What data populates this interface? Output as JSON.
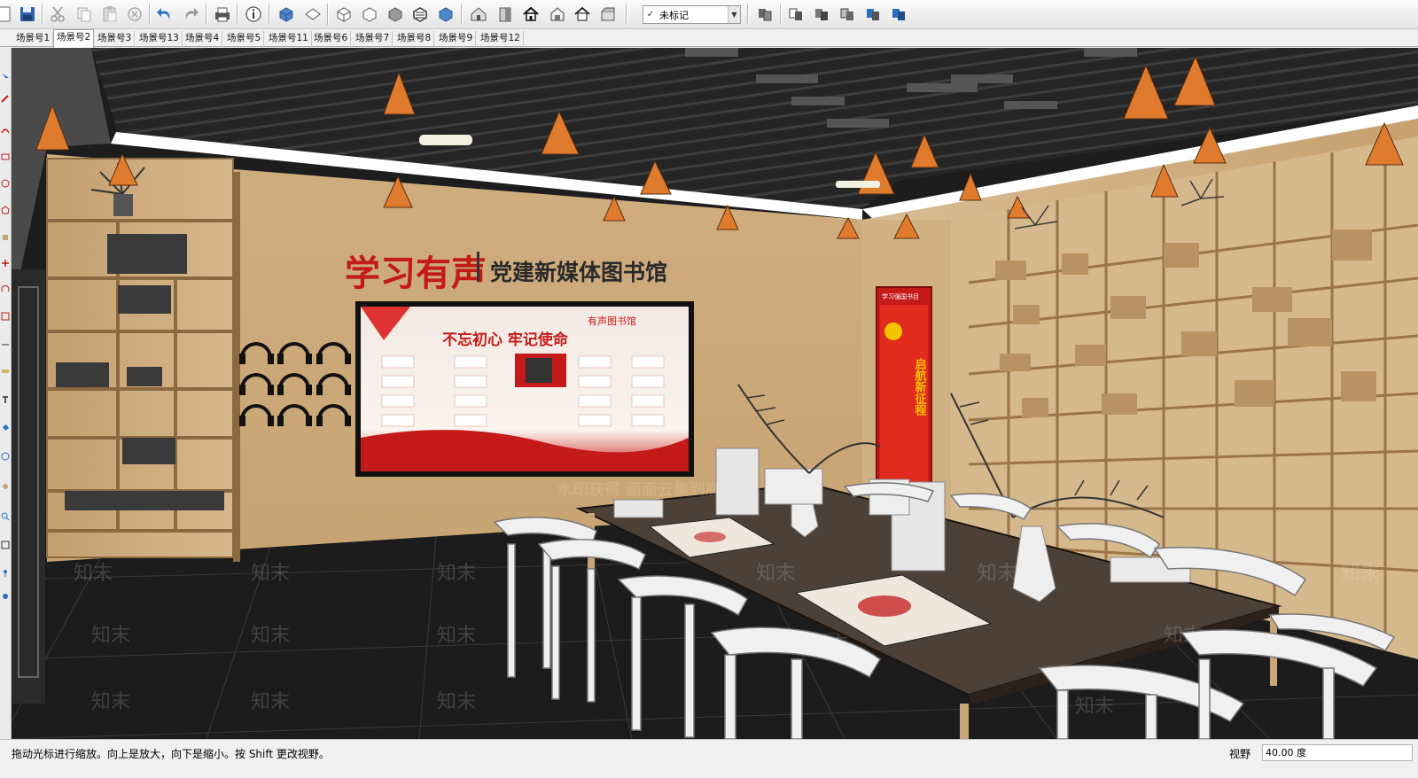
{
  "toolbar": {
    "tag_select": {
      "value": "未标记",
      "check": "✓"
    },
    "icons": [
      "new-file-icon",
      "save-icon",
      "cut-icon",
      "copy-icon",
      "paste-icon",
      "erase-icon",
      "undo-icon",
      "redo-icon",
      "print-icon",
      "model-info-icon",
      "iso-view-icon",
      "top-view-icon",
      "front-view-icon",
      "right-view-icon",
      "back-view-icon",
      "left-view-icon",
      "bottom-view-icon",
      "xray-icon",
      "wireframe-icon",
      "hidden-line-icon",
      "shaded-icon",
      "shaded-textures-icon",
      "monochrome-icon",
      "warehouse-icon",
      "component-icon",
      "house-icon",
      "house-outline-icon",
      "house-roof-icon",
      "extension-icon",
      "section-plane-icon",
      "section-display-icon",
      "section-cut-icon",
      "section-fill-icon",
      "section-toggle-icon"
    ]
  },
  "scenes": [
    "场景号1",
    "场景号2",
    "场景号3",
    "场景号13",
    "场景号4",
    "场景号5",
    "场景号11",
    "场景号6",
    "场景号7",
    "场景号8",
    "场景号9",
    "场景号12"
  ],
  "active_scene_index": 1,
  "viewport": {
    "logo_text": "学习有声",
    "headline": "党建新媒体图书馆",
    "screen_title": "不忘初心 牢记使命",
    "screen_header": "有声图书馆",
    "poster_top": "学习强国书目",
    "poster_slogan": "启航新征程",
    "watermark_text": "知末",
    "watermark_banner": "水印获得 画面云集到底"
  },
  "statusbar": {
    "hint": "拖动光标进行缩放。向上是放大，向下是缩小。按 Shift 更改视野。",
    "vcb_label": "视野",
    "vcb_value": "40.00 度"
  },
  "colors": {
    "accent_blue": "#2c6fbf",
    "party_red": "#c41a1a",
    "wood": "#c9a679",
    "floor": "#1f1f1f",
    "light_orange": "#e07b2e"
  }
}
